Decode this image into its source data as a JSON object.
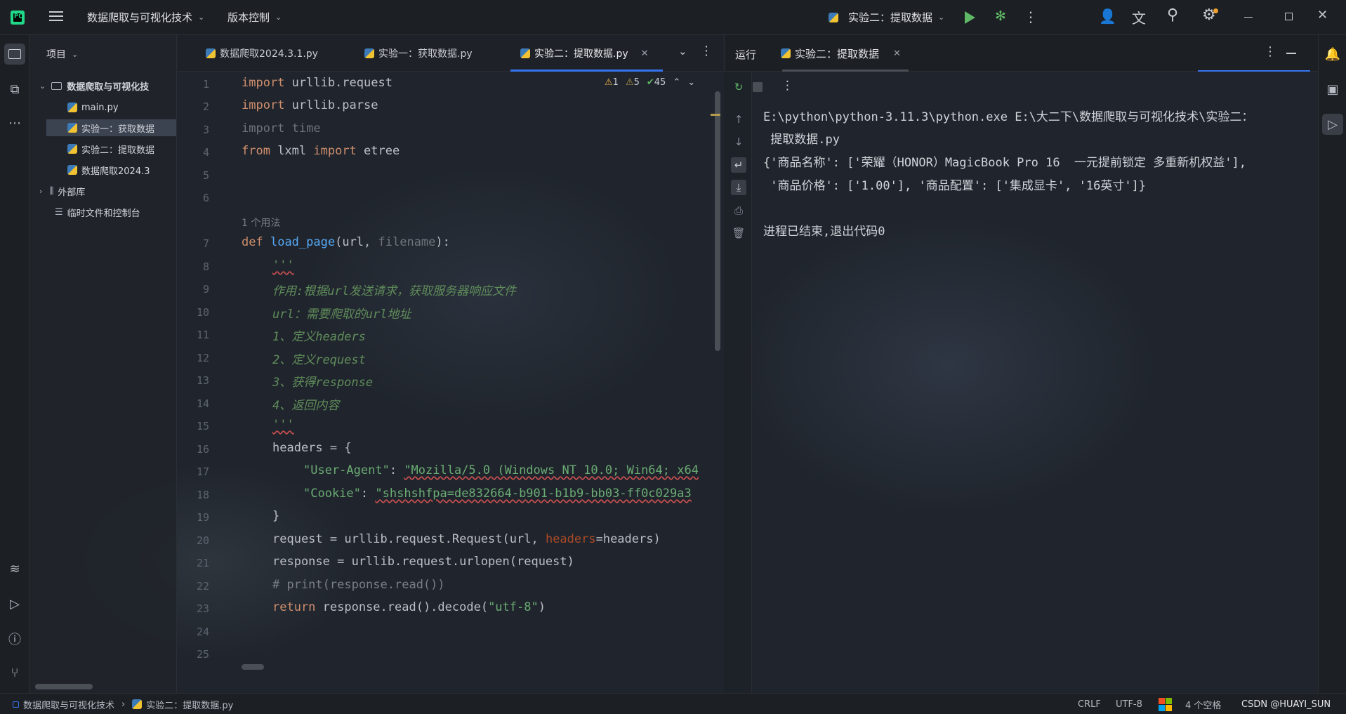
{
  "titlebar": {
    "project_name": "数据爬取与可视化技术",
    "vcs_menu": "版本控制",
    "run_config": "实验二：提取数据"
  },
  "project_pane": {
    "title": "项目",
    "root": "数据爬取与可视化技",
    "files": [
      "main.py",
      "实验一：获取数据",
      "实验二：提取数据",
      "数据爬取2024.3"
    ],
    "external_libs": "外部库",
    "scratches": "临时文件和控制台"
  },
  "editor": {
    "tabs": [
      "数据爬取2024.3.1.py",
      "实验一：获取数据.py",
      "实验二：提取数据.py"
    ],
    "inspections": {
      "errors": "1",
      "warnings": "5",
      "ok": "45"
    },
    "usages_hint": "1 个用法",
    "line_numbers": [
      "1",
      "2",
      "3",
      "4",
      "5",
      "6",
      "7",
      "8",
      "9",
      "10",
      "11",
      "12",
      "13",
      "14",
      "15",
      "16",
      "17",
      "18",
      "19",
      "20",
      "21",
      "22",
      "23",
      "24",
      "25"
    ],
    "code": {
      "l1_kw": "import",
      "l1_rest": " urllib.request",
      "l2_kw": "import",
      "l2_rest": " urllib.parse",
      "l3": "import time",
      "l4_kw1": "from",
      "l4_mod": " lxml ",
      "l4_kw2": "import",
      "l4_rest": " etree",
      "l7_kw": "def",
      "l7_fn": "load_page",
      "l7_p1": "(url, ",
      "l7_p2": "filename",
      "l7_p3": "):",
      "l8": "'''",
      "l9": "作用:根据url发送请求，获取服务器响应文件",
      "l10": "url：需要爬取的url地址",
      "l11": "1、定义headers",
      "l12": "2、定义request",
      "l13": "3、获得response",
      "l14": "4、返回内容",
      "l15": "'''",
      "l16": "headers = {",
      "l17_key": "\"User-Agent\"",
      "l17_sep": ": ",
      "l17_val": "\"Mozilla/5.0 (Windows NT 10.0; Win64; x64",
      "l18_key": "\"Cookie\"",
      "l18_sep": ": ",
      "l18_val": "\"shshshfpa=de832664-b901-b1b9-bb03-ff0c029a3",
      "l19": "}",
      "l20_a": "request = urllib.request.Request(url, ",
      "l20_param": "headers",
      "l20_b": "=headers)",
      "l21": "response = urllib.request.urlopen(request)",
      "l22": "# print(response.read())",
      "l23_kw": "return",
      "l23_a": " response.read().decode(",
      "l23_str": "\"utf-8\"",
      "l23_b": ")"
    }
  },
  "run_panel": {
    "label": "运行",
    "tab": "实验二：提取数据",
    "console": [
      "E:\\python\\python-3.11.3\\python.exe E:\\大二下\\数据爬取与可视化技术\\实验二：",
      " 提取数据.py",
      "{'商品名称': ['荣耀（HONOR）MagicBook Pro 16  一元提前锁定 多重新机权益'],",
      " '商品价格': ['1.00'], '商品配置': ['集成显卡', '16英寸']}",
      "",
      "进程已结束,退出代码0"
    ]
  },
  "statusbar": {
    "project": "数据爬取与可视化技术",
    "file": "实验二：提取数据.py",
    "line_sep": "CRLF",
    "encoding": "UTF-8",
    "indent": "4 个空格",
    "watermark": "CSDN @HUAYI_SUN"
  },
  "colors": {
    "accent": "#3574f0",
    "keyword": "#cf8e6d",
    "string": "#6aab73",
    "function": "#56a8f5",
    "run_green": "#5fb865"
  }
}
